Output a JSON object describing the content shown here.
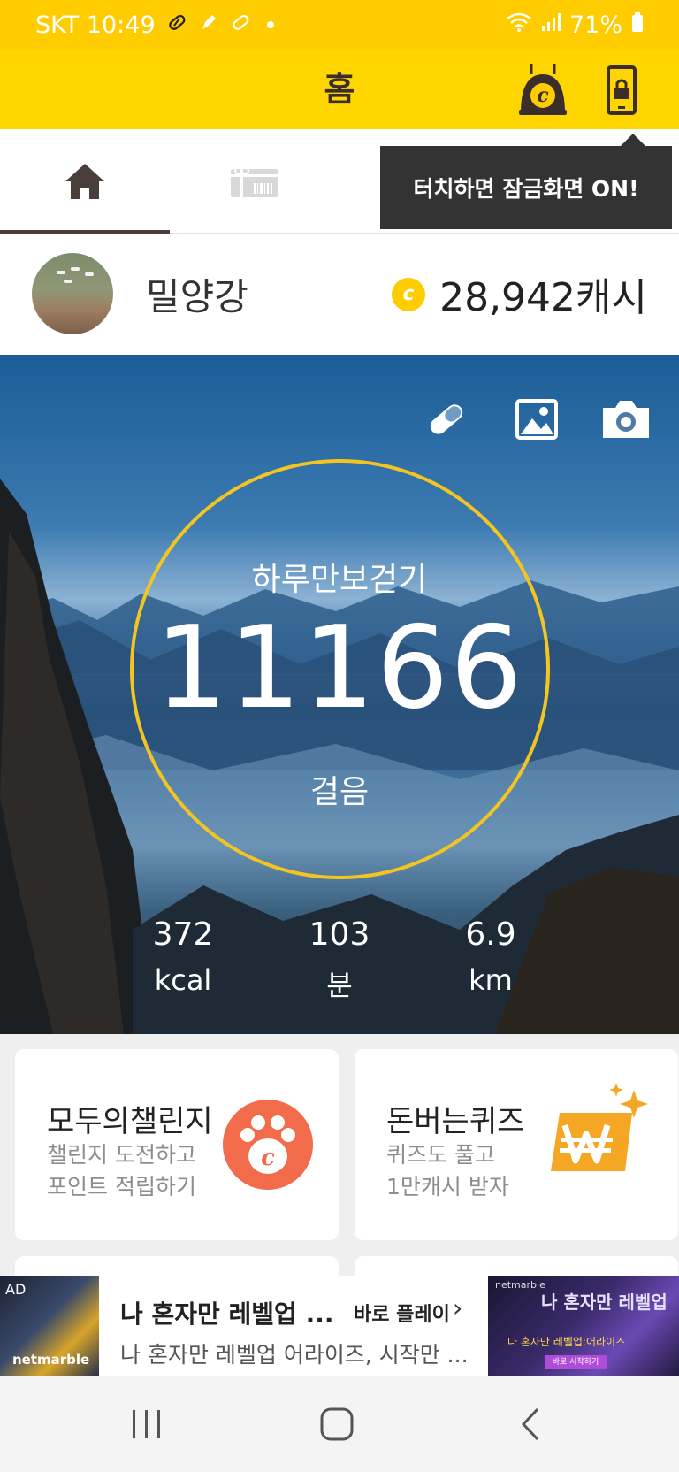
{
  "status_bar": {
    "carrier_time": "SKT 10:49",
    "battery": "71%",
    "icons": [
      "pill-icon",
      "pen-icon",
      "pill-icon",
      "dot-icon",
      "wifi-icon",
      "signal-icon",
      "battery-icon"
    ]
  },
  "app_bar": {
    "title": "홈",
    "buttons": [
      "cash-coin-icon",
      "lock-screen-icon"
    ]
  },
  "tabs": [
    {
      "name": "home",
      "icon": "home-icon",
      "active": true
    },
    {
      "name": "gift",
      "icon": "gift-icon",
      "active": false
    }
  ],
  "tooltip": {
    "text": "터치하면 잠금화면 ON!"
  },
  "profile": {
    "name": "밀양강",
    "cash": "28,942캐시",
    "cash_icon_letter": "c"
  },
  "hero": {
    "tool_icons": [
      "pill-icon",
      "image-icon",
      "camera-icon"
    ],
    "label": "하루만보걷기",
    "steps": "11166",
    "steps_unit": "걸음",
    "ring_color": "#f2c522",
    "stats": [
      {
        "value": "372",
        "unit": "kcal"
      },
      {
        "value": "103",
        "unit": "분"
      },
      {
        "value": "6.9",
        "unit": "km"
      }
    ]
  },
  "cards": [
    {
      "title": "모두의챌린지",
      "desc_line1": "챌린지 도전하고",
      "desc_line2": "포인트 적립하기",
      "icon": "paw-coin-icon",
      "icon_color": "#f26b4a"
    },
    {
      "title": "돈버는퀴즈",
      "desc_line1": "퀴즈도 풀고",
      "desc_line2": "1만캐시 받자",
      "icon": "won-sparkle-icon",
      "icon_color": "#f5a623"
    }
  ],
  "ad": {
    "tag": "AD",
    "brand": "netmarble",
    "title": "나 혼자만 레벨업 ...",
    "cta": "바로 플레이",
    "desc": "나 혼자만 레벨업 어라이즈, 시작만 ...",
    "banner_brand": "netmarble",
    "banner_title": "나 혼자만 레벨업",
    "banner_sub": "나 혼자만 레벨업:어라이즈",
    "banner_button": "바로 시작하기"
  },
  "nav_bar": {
    "buttons": [
      "recent-apps-icon",
      "home-icon",
      "back-icon"
    ]
  },
  "colors": {
    "brand_yellow": "#ffd500",
    "status_yellow": "#ffcc00",
    "dark_brown": "#3b2e2a"
  }
}
